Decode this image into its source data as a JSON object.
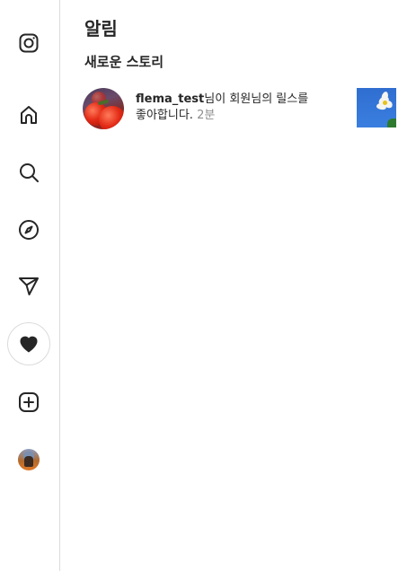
{
  "sidebar": {
    "items": [
      {
        "name": "instagram-logo",
        "icon": "instagram-icon"
      },
      {
        "name": "home",
        "icon": "home-icon"
      },
      {
        "name": "search",
        "icon": "search-icon"
      },
      {
        "name": "explore",
        "icon": "compass-icon"
      },
      {
        "name": "messages",
        "icon": "paper-plane-icon"
      },
      {
        "name": "notifications",
        "icon": "heart-filled-icon",
        "active": true
      },
      {
        "name": "create",
        "icon": "plus-square-icon"
      },
      {
        "name": "profile",
        "icon": "profile-avatar"
      }
    ]
  },
  "panel": {
    "title": "알림",
    "section_title": "새로운 스토리",
    "notifications": [
      {
        "username": "flema_test",
        "message": "님이 회원님의 릴스를 좋아합니다.",
        "time": "2분"
      }
    ]
  },
  "colors": {
    "text": "#262626",
    "secondary_text": "#8e8e8e",
    "border": "#dbdbdb",
    "background": "#ffffff"
  }
}
